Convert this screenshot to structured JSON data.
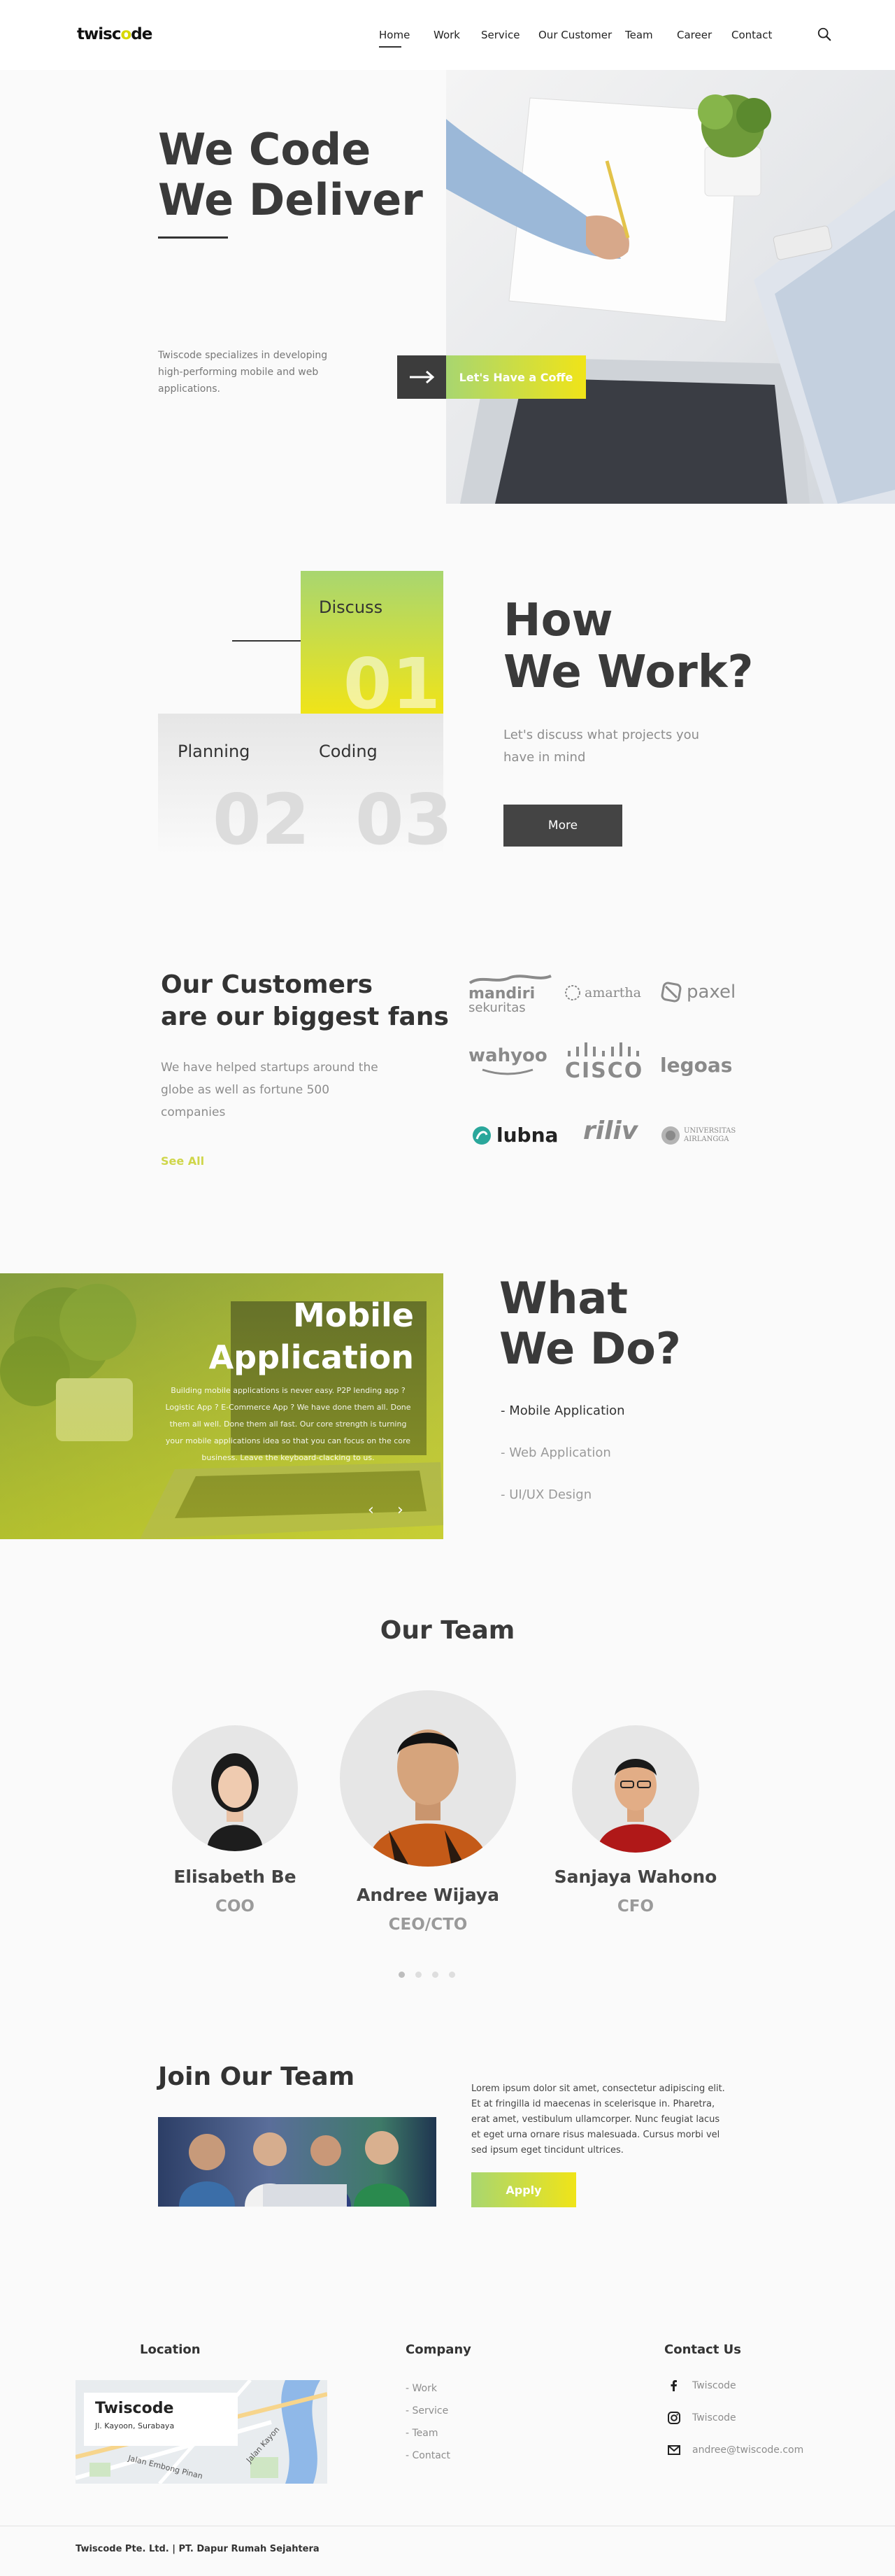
{
  "header": {
    "logo_prefix": "twisc",
    "logo_highlight": "o",
    "logo_suffix": "de",
    "nav": [
      "Home",
      "Work",
      "Service",
      "Our Customer",
      "Team",
      "Career",
      "Contact"
    ]
  },
  "hero": {
    "title_line1": "We Code",
    "title_line2": "We Deliver",
    "description": "Twiscode specializes in developing high-performing mobile and web applications.",
    "cta_label": "Let's Have a Coffe"
  },
  "how_we_work": {
    "steps": [
      {
        "label": "Discuss",
        "number": "01"
      },
      {
        "label": "Planning",
        "number": "02"
      },
      {
        "label": "Coding",
        "number": "03"
      }
    ],
    "title_line1": "How",
    "title_line2": "We Work?",
    "subtitle": "Let's discuss what projects you have in mind",
    "more_label": "More"
  },
  "customers": {
    "title_line1": "Our Customers",
    "title_line2": "are our biggest fans",
    "description": "We have helped startups around the globe as well as fortune 500 companies",
    "see_all": "See All",
    "logos": {
      "mandiri_line1": "mandiri",
      "mandiri_line2": "sekuritas",
      "amartha": "amartha",
      "paxel": "paxel",
      "wahyoo": "wahyoo",
      "cisco": "CISCO",
      "legoas": "legoas",
      "lubna": "lubna",
      "riliv": "riliv",
      "unair_line1": "UNIVERSITAS",
      "unair_line2": "AIRLANGGA"
    }
  },
  "what_we_do": {
    "slide_title_line1": "Mobile",
    "slide_title_line2": "Application",
    "slide_description": "Building mobile applications is never easy. P2P lending app ? Logistic App ? E-Commerce App ? We have done them all. Done them all well. Done them all fast. Our core strength is turning your mobile applications idea so that you can focus on the core business. Leave the keyboard-clacking to us.",
    "title_line1": "What",
    "title_line2": "We Do?",
    "services": [
      "- Mobile Application",
      "- Web Application",
      "- UI/UX Design"
    ],
    "colors": {
      "active": "#333333",
      "inactive": "#9a9a9a"
    }
  },
  "team": {
    "title": "Our Team",
    "members": [
      {
        "name": "Elisabeth Be",
        "role": "COO"
      },
      {
        "name": "Andree Wijaya",
        "role": "CEO/CTO"
      },
      {
        "name": "Sanjaya Wahono",
        "role": "CFO"
      }
    ],
    "active_dot": 0,
    "dot_count": 4
  },
  "join": {
    "title": "Join Our Team",
    "description": "Lorem ipsum dolor sit amet, consectetur adipiscing elit. Et at fringilla id maecenas in scelerisque in. Pharetra, erat amet, vestibulum ullamcorper. Nunc feugiat lacus et eget urna ornare risus malesuada. Cursus morbi vel sed ipsum eget tincidunt ultrices.",
    "apply_label": "Apply"
  },
  "footer": {
    "location_heading": "Location",
    "company_heading": "Company",
    "contact_heading": "Contact Us",
    "map_title": "Twiscode",
    "map_address": "Jl. Kayoon, Surabaya",
    "map_street1": "Jalan Embong Pinan",
    "map_street2": "Jalan Kayon",
    "company_links": [
      "- Work",
      "- Service",
      "- Team",
      "- Contact"
    ],
    "contacts": [
      {
        "icon": "facebook-icon",
        "text": "Twiscode"
      },
      {
        "icon": "instagram-icon",
        "text": "Twiscode"
      },
      {
        "icon": "mail-icon",
        "text": "andree@twiscode.com"
      }
    ],
    "copyright": "Twiscode Pte. Ltd. | PT. Dapur Rumah Sejahtera"
  },
  "colors": {
    "accent_green": "#a8d670",
    "accent_yellow": "#f0e418",
    "dark": "#3a3a3a"
  }
}
